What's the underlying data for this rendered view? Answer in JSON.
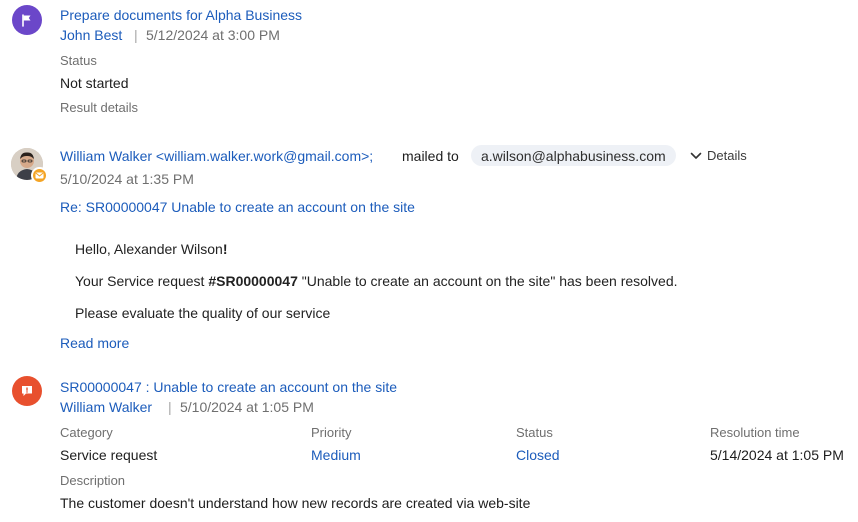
{
  "task": {
    "title": "Prepare documents for Alpha Business",
    "author": "John Best",
    "separator": "|",
    "timestamp": "5/12/2024 at 3:00 PM",
    "status_label": "Status",
    "status_value": "Not started",
    "result_details_label": "Result details",
    "icon": "flag-icon",
    "color": "#6b47c9"
  },
  "email": {
    "sender": "William Walker <william.walker.work@gmail.com>;",
    "mailed_to_label": "mailed to",
    "recipient": "a.wilson@alphabusiness.com",
    "details_label": "Details",
    "timestamp": "5/10/2024 at 1:35 PM",
    "subject": "Re: SR00000047 Unable to create an account on the site",
    "greeting_prefix": "Hello, Alexander Wilson",
    "greeting_suffix": "!",
    "line2_prefix": "Your Service request ",
    "line2_bold": "#SR00000047",
    "line2_suffix": " \"Unable to create an account on the site\" has been resolved.",
    "line3": "Please evaluate the quality of our service",
    "read_more": "Read more",
    "badge_color": "#f4a425"
  },
  "case": {
    "title": "SR00000047 : Unable to create an account on the site",
    "author": "William Walker",
    "separator": "|",
    "timestamp": "5/10/2024 at 1:05 PM",
    "category_label": "Category",
    "category_value": "Service request",
    "priority_label": "Priority",
    "priority_value": "Medium",
    "status_label": "Status",
    "status_value": "Closed",
    "resolution_label": "Resolution time",
    "resolution_value": "5/14/2024 at 1:05 PM",
    "description_label": "Description",
    "description_value": "The customer doesn't understand how new records are created via web-site",
    "icon": "alert-icon",
    "color": "#e8502e"
  }
}
